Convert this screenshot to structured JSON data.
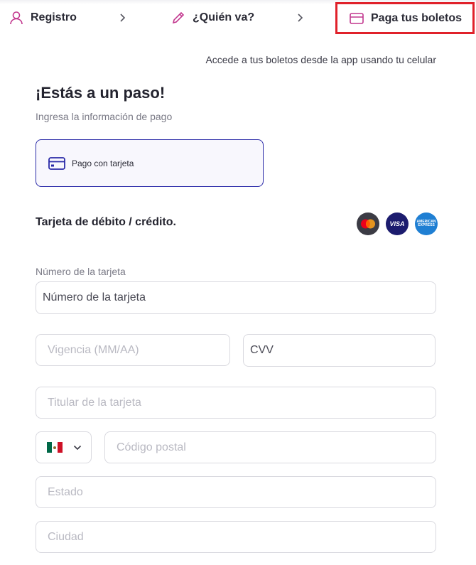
{
  "stepper": {
    "steps": [
      {
        "label": "Registro",
        "icon": "user-icon"
      },
      {
        "label": "¿Quién va?",
        "icon": "pencil-icon"
      },
      {
        "label": "Paga tus boletos",
        "icon": "credit-card-icon"
      }
    ],
    "active_step": 3,
    "colors": {
      "accent": "#c2378e",
      "highlight_border": "#e0212a"
    }
  },
  "app_note": "Accede a tus boletos desde la app usando tu celular",
  "heading": {
    "title": "¡Estás a un paso!",
    "subtitle": "Ingresa la información de pago"
  },
  "payment_method": {
    "label": "Pago con tarjeta",
    "icon": "credit-card-icon",
    "selected": true,
    "border_color": "#2a2aa8"
  },
  "card_section": {
    "title": "Tarjeta de débito / crédito.",
    "brands": [
      {
        "name": "mastercard-icon"
      },
      {
        "name": "visa-icon",
        "text": "VISA"
      },
      {
        "name": "amex-icon",
        "text": "AMERICAN EXPRESS"
      }
    ]
  },
  "form": {
    "card_number_label": "Número de la tarjeta",
    "card_number_placeholder": "Número de la tarjeta",
    "expiry_placeholder": "Vigencia (MM/AA)",
    "cvv_placeholder": "CVV",
    "holder_placeholder": "Titular de la tarjeta",
    "country_flag": "mexico-flag-icon",
    "zip_placeholder": "Código postal",
    "state_placeholder": "Estado",
    "city_placeholder": "Ciudad"
  }
}
